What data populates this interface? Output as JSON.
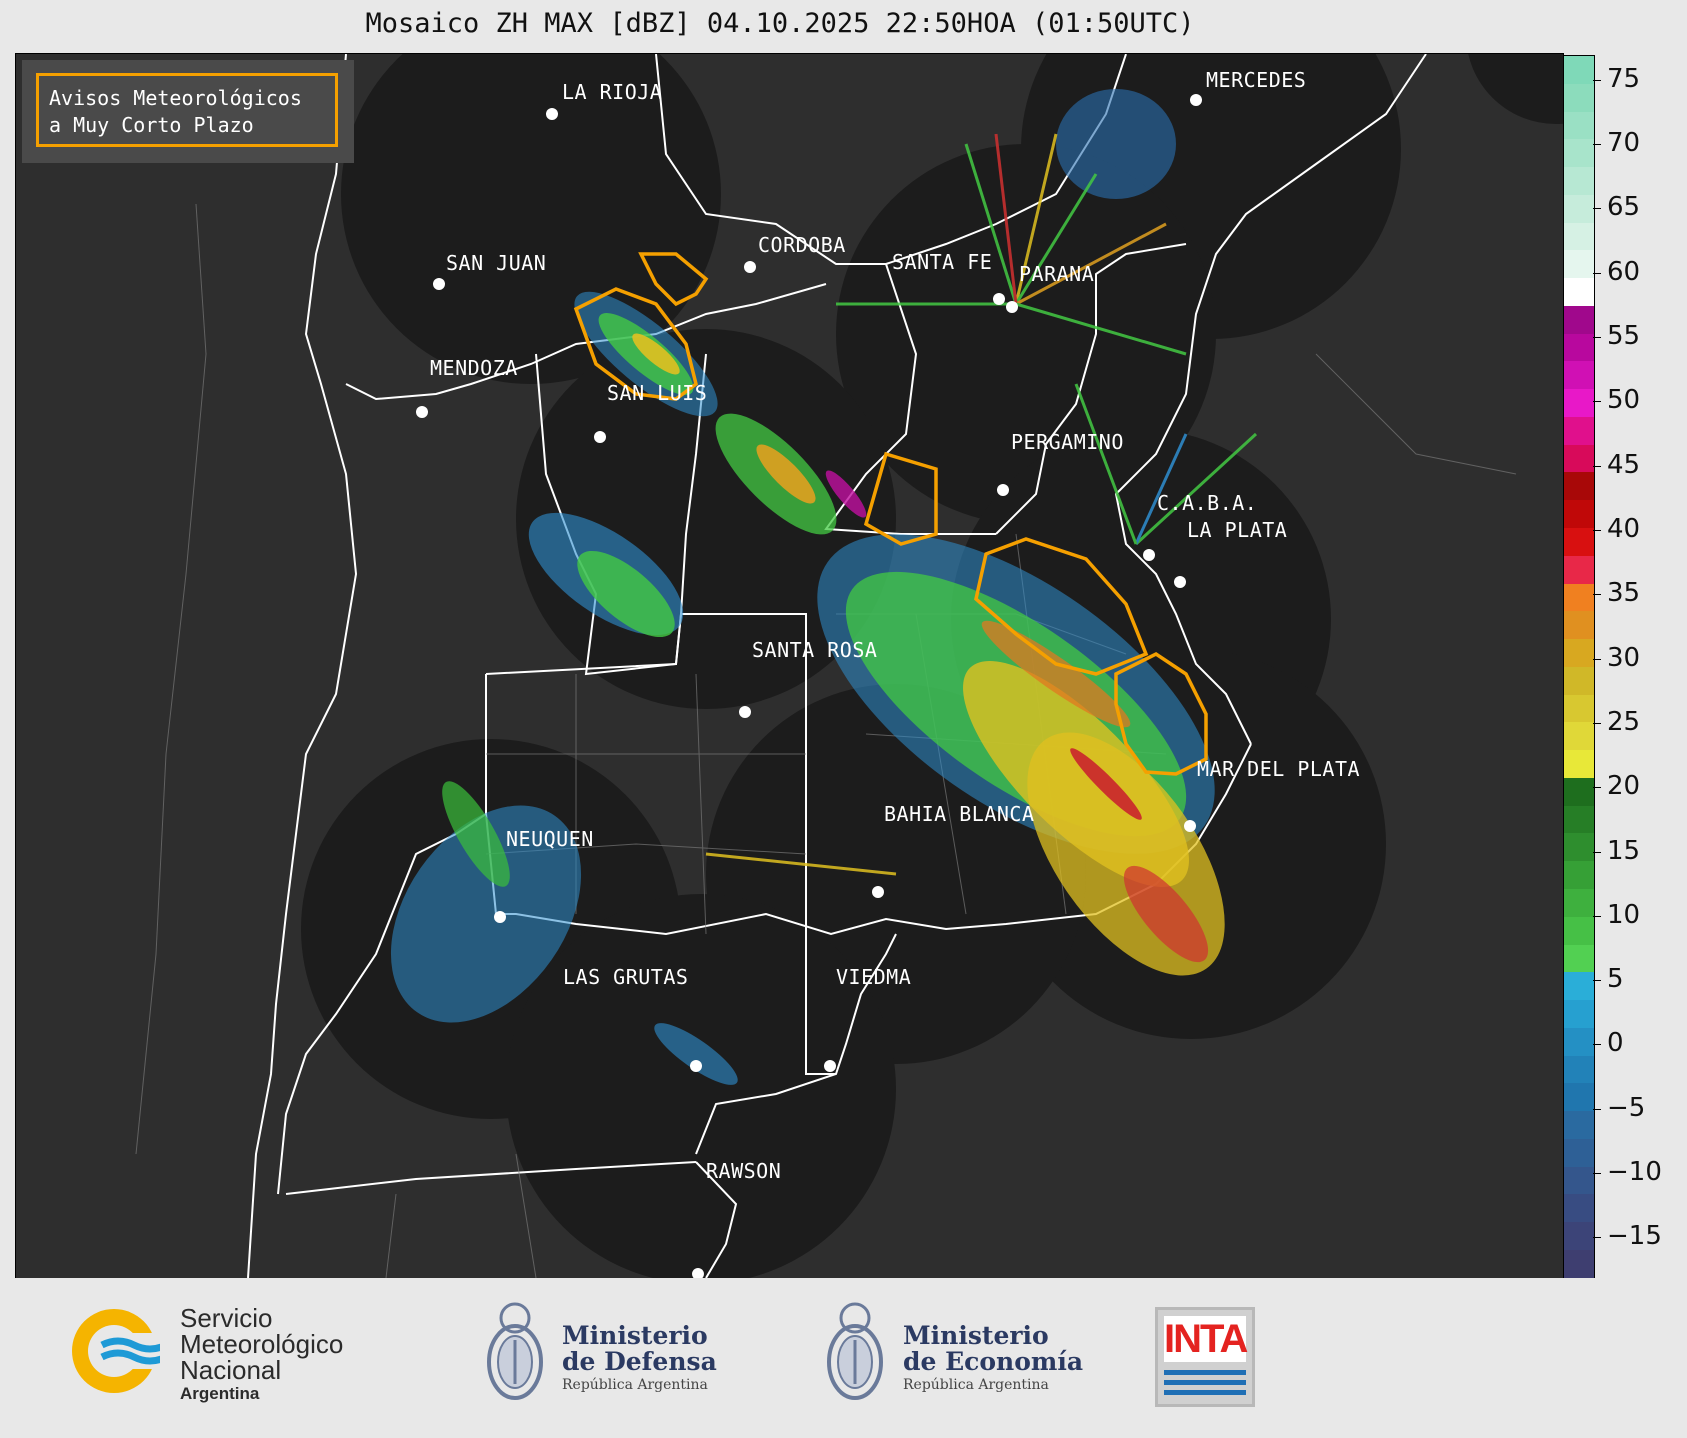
{
  "title": "Mosaico ZH MAX [dBZ] 04.10.2025 22:50HOA (01:50UTC)",
  "legend": {
    "line1": "Avisos Meteorológicos",
    "line2": "a Muy Corto Plazo",
    "border_color": "#f5a000"
  },
  "cities": [
    {
      "name": "LA RIOJA"
    },
    {
      "name": "MERCEDES"
    },
    {
      "name": "SAN JUAN"
    },
    {
      "name": "CORDOBA"
    },
    {
      "name": "SANTA FE"
    },
    {
      "name": "PARANA"
    },
    {
      "name": "MENDOZA"
    },
    {
      "name": "SAN LUIS"
    },
    {
      "name": "PERGAMINO"
    },
    {
      "name": "C.A.B.A."
    },
    {
      "name": "LA PLATA"
    },
    {
      "name": "SANTA ROSA"
    },
    {
      "name": "MAR DEL PLATA"
    },
    {
      "name": "BAHIA BLANCA"
    },
    {
      "name": "NEUQUEN"
    },
    {
      "name": "LAS GRUTAS"
    },
    {
      "name": "VIEDMA"
    },
    {
      "name": "RAWSON"
    }
  ],
  "colorbar": {
    "ticks": [
      "75",
      "70",
      "65",
      "60",
      "55",
      "50",
      "45",
      "40",
      "35",
      "30",
      "25",
      "20",
      "15",
      "10",
      "5",
      "0",
      "−5",
      "−10",
      "−15"
    ],
    "range": [
      -18,
      77
    ]
  },
  "footer": {
    "smn": {
      "line1": "Servicio",
      "line2": "Meteorológico",
      "line3": "Nacional",
      "line4": "Argentina"
    },
    "defensa": {
      "line1": "Ministerio",
      "line2": "de Defensa",
      "line3": "República Argentina"
    },
    "economia": {
      "line1": "Ministerio",
      "line2": "de Economía",
      "line3": "República Argentina"
    },
    "inta": {
      "label": "INTA"
    }
  }
}
